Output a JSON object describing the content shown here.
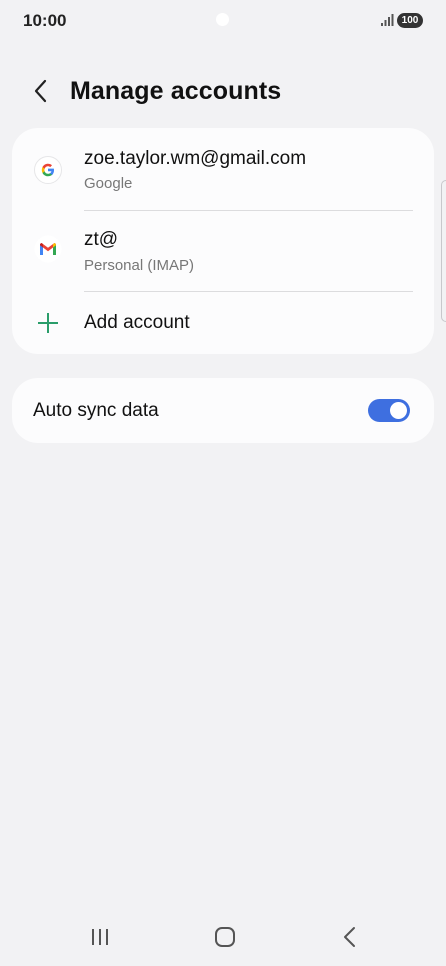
{
  "status_bar": {
    "time": "10:00",
    "battery": "100",
    "icons": [
      "camera-dot",
      "signal-icon",
      "battery-icon"
    ]
  },
  "header": {
    "back_icon": "chevron-left-icon",
    "title": "Manage accounts"
  },
  "accounts": [
    {
      "name": "zoe.taylor.wm@gmail.com",
      "type": "Google",
      "icon": "google-icon"
    },
    {
      "name": "zt@",
      "type": "Personal (IMAP)",
      "icon": "gmail-icon"
    }
  ],
  "add_account": {
    "label": "Add account",
    "icon": "plus-icon"
  },
  "sync": {
    "label": "Auto sync data",
    "enabled": true
  },
  "nav_bar": {
    "icons": [
      "recent-apps-icon",
      "home-icon",
      "back-icon"
    ]
  },
  "colors": {
    "background": "#f2f2f4",
    "card": "#fcfcfd",
    "toggle_on": "#3e6fe0",
    "plus_accent": "#2a9d6a"
  }
}
